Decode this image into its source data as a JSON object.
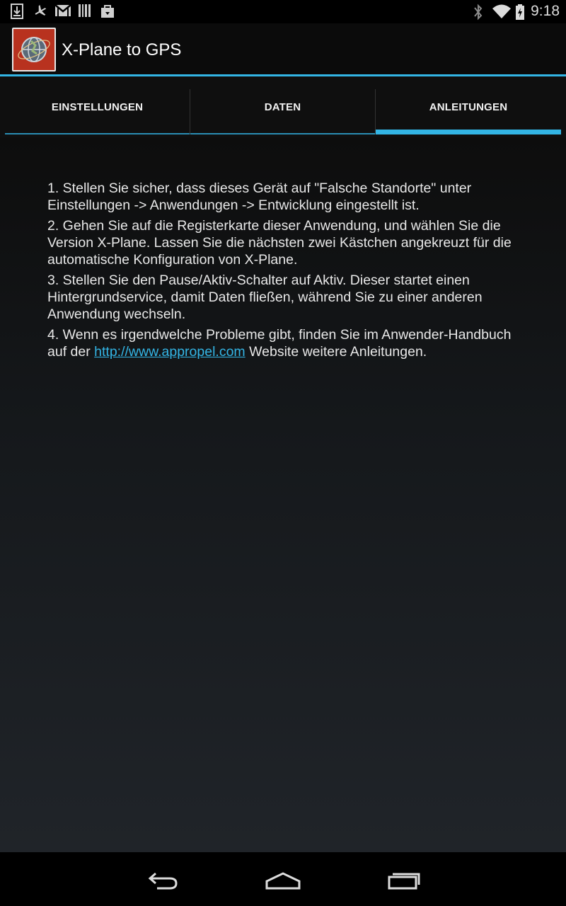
{
  "status_bar": {
    "time": "9:18",
    "left_icons": [
      "download-icon",
      "airplane-icon",
      "gmail-icon",
      "barcode-icon",
      "shopping-bag-icon"
    ],
    "right_icons": [
      "bluetooth-icon",
      "wifi-icon",
      "battery-charging-icon"
    ]
  },
  "action_bar": {
    "title": "X-Plane to GPS",
    "app_icon": "globe-icon"
  },
  "tabs": [
    {
      "label": "EINSTELLUNGEN",
      "selected": false
    },
    {
      "label": "DATEN",
      "selected": false
    },
    {
      "label": "ANLEITUNGEN",
      "selected": true
    }
  ],
  "instructions": {
    "step1": "1. Stellen Sie sicher, dass dieses Gerät auf \"Falsche Standorte\" unter Einstellungen -> Anwendungen -> Entwicklung eingestellt ist.",
    "step2": "2. Gehen Sie auf die Registerkarte dieser Anwendung, und wählen Sie die Version X-Plane. Lassen Sie die nächsten zwei Kästchen angekreuzt für die automatische Konfiguration von X-Plane.",
    "step3": "3. Stellen Sie den Pause/Aktiv-Schalter auf Aktiv. Dieser startet einen Hintergrundservice, damit Daten fließen, während Sie zu einer anderen Anwendung wechseln.",
    "step4_before": "4. Wenn es irgendwelche Probleme gibt, finden Sie im Anwender-Handbuch auf der ",
    "step4_link": "http://www.appropel.com",
    "step4_after": " Website weitere Anleitungen."
  },
  "nav_bar": {
    "buttons": [
      "back-icon",
      "home-icon",
      "recent-apps-icon"
    ]
  },
  "colors": {
    "accent": "#33b5e5",
    "app_icon_bg": "#b8321f"
  }
}
